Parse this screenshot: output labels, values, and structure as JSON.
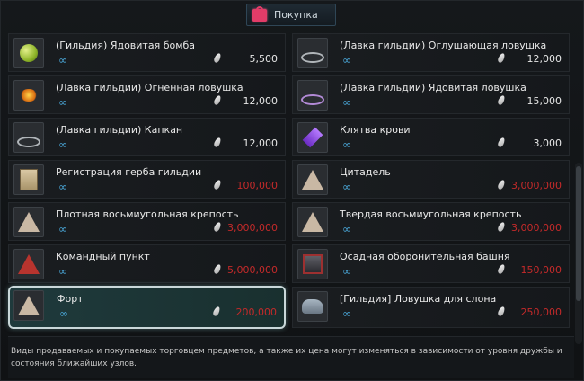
{
  "tab": {
    "label": "Покупка",
    "icon": "shopping-bag-icon"
  },
  "infinity_symbol": "∞",
  "items": [
    {
      "name": "(Гильдия) Ядовитая бомба",
      "price": "5,500",
      "price_color": "#e6e6e6",
      "icon": "poison-bomb-icon",
      "selected": false
    },
    {
      "name": "(Лавка гильдии) Оглушающая ловушка",
      "price": "12,000",
      "price_color": "#e6e6e6",
      "icon": "stun-trap-icon",
      "selected": false
    },
    {
      "name": "(Лавка гильдии) Огненная ловушка",
      "price": "12,000",
      "price_color": "#e6e6e6",
      "icon": "fire-trap-icon",
      "selected": false
    },
    {
      "name": "(Лавка гильдии) Ядовитая ловушка",
      "price": "15,000",
      "price_color": "#e6e6e6",
      "icon": "poison-trap-icon",
      "selected": false
    },
    {
      "name": "(Лавка гильдии) Капкан",
      "price": "12,000",
      "price_color": "#e6e6e6",
      "icon": "bear-trap-icon",
      "selected": false
    },
    {
      "name": "Клятва крови",
      "price": "3,000",
      "price_color": "#e6e6e6",
      "icon": "blood-oath-icon",
      "selected": false
    },
    {
      "name": "Регистрация герба гильдии",
      "price": "100,000",
      "price_color": "#c42a2a",
      "icon": "guild-crest-document-icon",
      "selected": false
    },
    {
      "name": "Цитадель",
      "price": "3,000,000",
      "price_color": "#c42a2a",
      "icon": "citadel-tent-icon",
      "selected": false
    },
    {
      "name": "Плотная восьмиугольная крепость",
      "price": "3,000,000",
      "price_color": "#c42a2a",
      "icon": "octagonal-fortress-tent-icon",
      "selected": false
    },
    {
      "name": "Твердая восьмиугольная крепость",
      "price": "3,000,000",
      "price_color": "#c42a2a",
      "icon": "solid-octagonal-fortress-tent-icon",
      "selected": false
    },
    {
      "name": "Командный пункт",
      "price": "5,000,000",
      "price_color": "#c42a2a",
      "icon": "command-post-tent-icon",
      "selected": false
    },
    {
      "name": "Осадная оборонительная башня",
      "price": "150,000",
      "price_color": "#c42a2a",
      "icon": "siege-tower-icon",
      "selected": false
    },
    {
      "name": "Форт",
      "price": "200,000",
      "price_color": "#c42a2a",
      "icon": "fort-tent-icon",
      "selected": true
    },
    {
      "name": "[Гильдия] Ловушка для слона",
      "price": "250,000",
      "price_color": "#c42a2a",
      "icon": "elephant-trap-icon",
      "selected": false
    }
  ],
  "footer": {
    "text": "Виды продаваемых и покупаемых торговцем предметов, а также их цена могут изменяться в зависимости от уровня дружбы и состояния ближайших узлов."
  }
}
